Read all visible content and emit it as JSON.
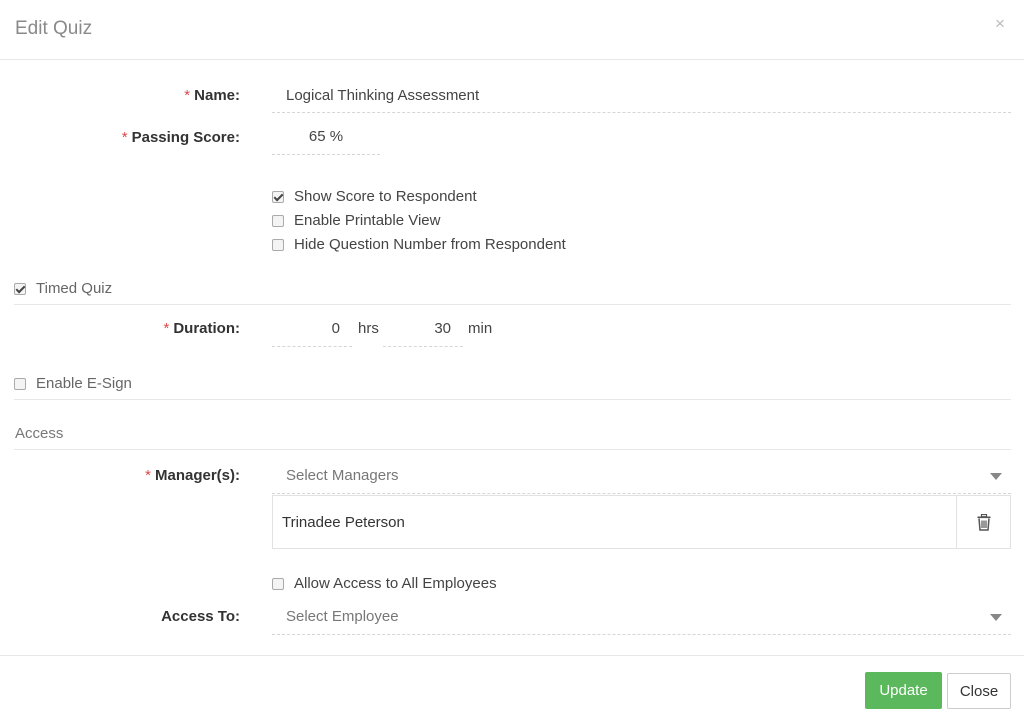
{
  "dialog": {
    "title": "Edit Quiz",
    "close_glyph": "×"
  },
  "form": {
    "required_marker": "*",
    "name": {
      "label": "Name:",
      "value": "Logical Thinking Assessment"
    },
    "passing_score": {
      "label": "Passing Score:",
      "value": "65 %"
    },
    "options": [
      {
        "label": "Show Score to Respondent",
        "checked": true
      },
      {
        "label": "Enable Printable View",
        "checked": false
      },
      {
        "label": "Hide Question Number from Respondent",
        "checked": false
      }
    ],
    "timed_quiz": {
      "label": "Timed Quiz",
      "checked": true
    },
    "duration": {
      "label": "Duration:",
      "hours": "0",
      "hours_unit": "hrs",
      "minutes": "30",
      "minutes_unit": "min"
    },
    "esign": {
      "label": "Enable E-Sign",
      "checked": false
    },
    "access_section": "Access",
    "managers": {
      "label": "Manager(s):",
      "placeholder": "Select Managers",
      "selected": [
        "Trinadee Peterson"
      ]
    },
    "allow_all": {
      "label": "Allow Access to All Employees",
      "checked": false
    },
    "access_to": {
      "label": "Access To:",
      "placeholder": "Select Employee"
    }
  },
  "footer": {
    "update_label": "Update",
    "close_label": "Close"
  },
  "colors": {
    "primary": "#5cb85c",
    "required": "#e04848"
  }
}
